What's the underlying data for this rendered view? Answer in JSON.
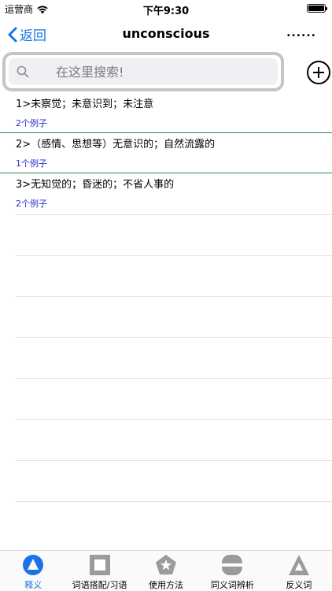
{
  "status_bar": {
    "carrier": "运营商",
    "time": "下午9:30"
  },
  "nav": {
    "back_label": "返回",
    "title": "unconscious",
    "more_label": "......"
  },
  "search": {
    "placeholder": "在这里搜索!"
  },
  "definitions": [
    {
      "text": "1>未察觉；未意识到；未注意",
      "examples": "2个例子"
    },
    {
      "text": "2>（感情、思想等）无意识的；自然流露的",
      "examples": "1个例子"
    },
    {
      "text": "3>无知觉的；昏迷的；不省人事的",
      "examples": "2个例子"
    }
  ],
  "tabs": [
    {
      "label": "释义",
      "icon": "triangle-circle-icon",
      "active": true
    },
    {
      "label": "词语搭配/习语",
      "icon": "square-icon",
      "active": false
    },
    {
      "label": "使用方法",
      "icon": "star-pentagon-icon",
      "active": false
    },
    {
      "label": "同义词辨析",
      "icon": "rounded-rect-icon",
      "active": false
    },
    {
      "label": "反义词",
      "icon": "triangle-icon",
      "active": false
    }
  ],
  "colors": {
    "accent": "#1a73e8",
    "divider": "#2f8a49",
    "example_link": "#2d2dd6",
    "inactive_icon": "#9b9b9b"
  }
}
